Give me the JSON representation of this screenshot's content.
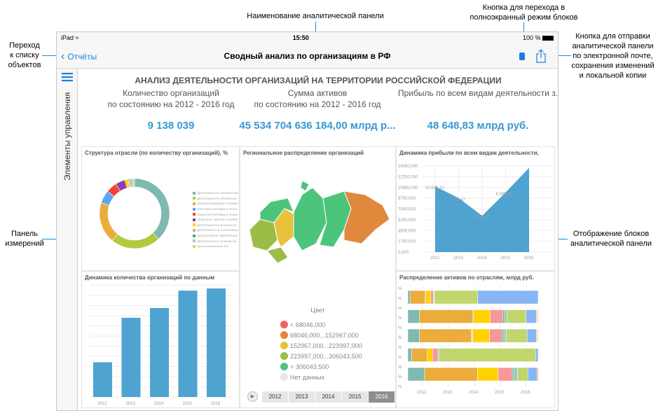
{
  "callouts": {
    "back": "Переход\nк списку\nобъектов",
    "title": "Наименование аналитической панели",
    "fullscreen": "Кнопка для перехода в\nполноэкранный режим блоков",
    "share": "Кнопка для отправки\nаналитической панели\nпо электронной почте,\nсохранения изменений\nи локальной копии",
    "dims": "Панель\nизмерений",
    "blocks": "Отображение блоков\nаналитической панели"
  },
  "status": {
    "device": "iPad",
    "time": "15:50",
    "battery": "100 %"
  },
  "nav": {
    "back_label": "Отчёты",
    "title": "Сводный анализ по организациям в РФ"
  },
  "sidebar": {
    "label": "Элементы управления"
  },
  "dashboard": {
    "title": "АНАЛИЗ ДЕЯТЕЛЬНОСТИ ОРГАНИЗАЦИЙ НА ТЕРРИТОРИИ РОССИЙСКОЙ ФЕДЕРАЦИИ",
    "kpis": [
      {
        "label1": "Количество организаций",
        "label2": "по состоянию на 2012 - 2016 год",
        "value": "9 138 039"
      },
      {
        "label1": "Сумма активов",
        "label2": "по состоянию на 2012 - 2016 год",
        "value": "45 534 704 636 184,00 млрд р..."
      },
      {
        "label1": "Прибыль по всем видам деятельности з...",
        "label2": "",
        "value": "48 648,83 млрд руб."
      }
    ]
  },
  "map": {
    "title": "Региональное распределение организаций",
    "legend_title": "Цвет",
    "legend": [
      {
        "label": "< 68046,000",
        "color": "#f26262"
      },
      {
        "label": "68046,000...152967,000",
        "color": "#e0883c"
      },
      {
        "label": "152967,000...223997,000",
        "color": "#e8c23a"
      },
      {
        "label": "223997,000...306043,500",
        "color": "#9cbc48"
      },
      {
        "label": "> 306043,500",
        "color": "#4cc47c"
      },
      {
        "label": "Нет данных",
        "color": "#e6e6e6"
      }
    ],
    "years": [
      "2012",
      "2013",
      "2014",
      "2015",
      "2016"
    ],
    "selected_year": "2016"
  },
  "chart_data": [
    {
      "type": "pie",
      "title": "Структура отрасли (по количеству организаций), %",
      "labels": [
        "ДЕЯТЕЛЬНОСТЬ ФИНАНСОВА...",
        "ДЕЯТЕЛЬНОСТЬ ПРОФЕССИ...",
        "ОБРАБАТЫВАЮЩИЕ ПРОИЗВ...",
        "ТОРГОВЛЯ ОПТОВАЯ И РОЗН...",
        "ТРАНСПОРТИРОВКА И ХРАНЕ...",
        "СЕЛЬСКОЕ, ЛЕСНОЕ ХОЗЯЙС...",
        "ДЕЯТЕЛЬНОСТЬ В ОБЛАСТИ...",
        "ДЕЯТЕЛЬНОСТЬ ГОСТИНИЦ И...",
        "ОБЕСПЕЧЕНИЕ ЭЛЕКТРИЧЕС...",
        "ДЕЯТЕЛЬНОСТЬ В ОБЛАСТИ...",
        "Прочие (элементов: 10)"
      ],
      "values": [
        38,
        23,
        19,
        6,
        5,
        4.5,
        1.5,
        0.7,
        0.5,
        1,
        0.8
      ],
      "colors": [
        "#7fb9b1",
        "#b5c93f",
        "#ecac3c",
        "#5aa6f2",
        "#f5433a",
        "#8e3fa8",
        "#ffd200",
        "#f79898",
        "#4caa6a",
        "#9cc8c8",
        "#c6da7c"
      ]
    },
    {
      "type": "area",
      "title": "Динамика прибыли по всем видам деятельности,",
      "categories": [
        "2012",
        "2013",
        "2014",
        "2015",
        "2016"
      ],
      "values": [
        10675.1,
        8781.47,
        5906.6,
        9685.48,
        13700
      ],
      "data_labels": [
        "10 675,10",
        "8 781,47",
        "5 906,60",
        "9 685,48",
        ""
      ],
      "yticks": [
        "0,000",
        "1750,000",
        "3500,000",
        "5250,000",
        "7000,000",
        "8750,000",
        "10500,000",
        "12250,000",
        "14000,000"
      ],
      "ylim": [
        0,
        14000
      ],
      "color": "#4fa3d1"
    },
    {
      "type": "bar",
      "title": "Динамика количества организаций по данным",
      "categories": [
        "2012",
        "2013",
        "2014",
        "2015",
        "2016"
      ],
      "values": [
        0.32,
        0.73,
        0.82,
        0.98,
        1.0
      ],
      "color": "#4fa3d1"
    },
    {
      "type": "bar",
      "title": "Распределение активов по отраслям, млрд руб.",
      "orientation": "horizontal-stacked",
      "xticks": [
        "2012",
        "2013",
        "2014",
        "2015",
        "2016"
      ],
      "ytick": "%",
      "rows": [
        [
          [
            "#7fb9b1",
            2
          ],
          [
            "#ecac3c",
            11
          ],
          [
            "#8e3fa8",
            0.5
          ],
          [
            "#ffd200",
            4
          ],
          [
            "#f79898",
            2
          ],
          [
            "#cfe0d8",
            1
          ],
          [
            "#c1d66c",
            33
          ],
          [
            "#86b6f5",
            46.5
          ]
        ],
        [
          [
            "#7fb9b1",
            9
          ],
          [
            "#ecac3c",
            42
          ],
          [
            "#5aa6f2",
            0.5
          ],
          [
            "#ffd200",
            13
          ],
          [
            "#f79898",
            10
          ],
          [
            "#4caa6a",
            1
          ],
          [
            "#9cc8c8",
            2
          ],
          [
            "#c1d66c",
            15
          ],
          [
            "#86b6f5",
            8
          ],
          [
            "#ffd200",
            0.5
          ],
          [
            "#f7c0c0",
            1
          ]
        ],
        [
          [
            "#7fb9b1",
            9
          ],
          [
            "#ecac3c",
            40
          ],
          [
            "#cfe0d8",
            1
          ],
          [
            "#ffd200",
            13
          ],
          [
            "#f79898",
            10
          ],
          [
            "#4caa6a",
            1
          ],
          [
            "#9cc8c8",
            2
          ],
          [
            "#c1d66c",
            16
          ],
          [
            "#86b6f5",
            7
          ],
          [
            "#ffd200",
            0.5
          ],
          [
            "#f7c0c0",
            1
          ]
        ],
        [
          [
            "#7fb9b1",
            3
          ],
          [
            "#ecac3c",
            12
          ],
          [
            "#ffd200",
            4
          ],
          [
            "#f79898",
            4
          ],
          [
            "#9cc8c8",
            1
          ],
          [
            "#c1d66c",
            74
          ],
          [
            "#86b6f5",
            2
          ]
        ],
        [
          [
            "#7fb9b1",
            13
          ],
          [
            "#ecac3c",
            41
          ],
          [
            "#ffd200",
            16
          ],
          [
            "#f79898",
            11
          ],
          [
            "#4caa6a",
            1
          ],
          [
            "#9cc8c8",
            3
          ],
          [
            "#c1d66c",
            8
          ],
          [
            "#86b6f5",
            7
          ],
          [
            "#f79898",
            1
          ]
        ]
      ]
    }
  ]
}
